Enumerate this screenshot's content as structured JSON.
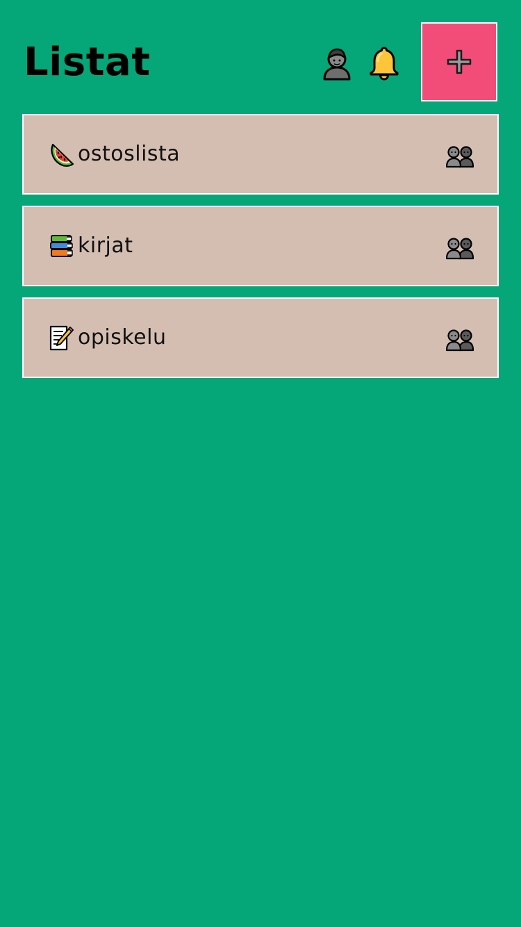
{
  "header": {
    "title": "Listat",
    "icons": {
      "profile": "person-icon",
      "notifications": "bell-icon",
      "add": "plus-icon"
    }
  },
  "lists": [
    {
      "name": "ostoslista",
      "emoji": "watermelon",
      "share_icon": "people-icon"
    },
    {
      "name": "kirjat",
      "emoji": "books",
      "share_icon": "people-icon"
    },
    {
      "name": "opiskelu",
      "emoji": "memo",
      "share_icon": "people-icon"
    }
  ],
  "colors": {
    "background": "#05a677",
    "add_button": "#f24d78",
    "list_item": "#d4beb2",
    "border": "#ffffff",
    "bell": "#fdc53a"
  }
}
